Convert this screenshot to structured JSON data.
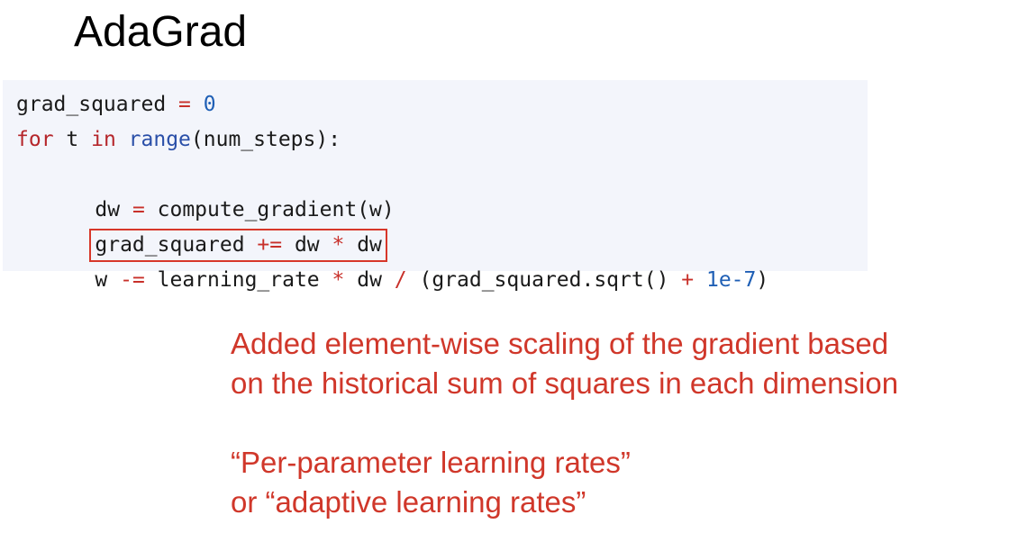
{
  "slide": {
    "title": "AdaGrad"
  },
  "code": {
    "line1": [
      {
        "t": "grad_squared ",
        "c": "plain"
      },
      {
        "t": "=",
        "c": "op"
      },
      {
        "t": " ",
        "c": "plain"
      },
      {
        "t": "0",
        "c": "num"
      }
    ],
    "line2": [
      {
        "t": "for",
        "c": "kw"
      },
      {
        "t": " t ",
        "c": "plain"
      },
      {
        "t": "in",
        "c": "kw"
      },
      {
        "t": " ",
        "c": "plain"
      },
      {
        "t": "range",
        "c": "fn"
      },
      {
        "t": "(num_steps):",
        "c": "plain"
      }
    ],
    "line3": [
      {
        "t": "dw ",
        "c": "plain"
      },
      {
        "t": "=",
        "c": "op"
      },
      {
        "t": " compute_gradient(w)",
        "c": "plain"
      }
    ],
    "line4": [
      {
        "t": "grad_squared ",
        "c": "plain"
      },
      {
        "t": "+=",
        "c": "op"
      },
      {
        "t": " dw ",
        "c": "plain"
      },
      {
        "t": "*",
        "c": "op"
      },
      {
        "t": " dw",
        "c": "plain"
      }
    ],
    "line5": [
      {
        "t": "w ",
        "c": "plain"
      },
      {
        "t": "-=",
        "c": "op"
      },
      {
        "t": " learning_rate ",
        "c": "plain"
      },
      {
        "t": "*",
        "c": "op"
      },
      {
        "t": " dw ",
        "c": "plain"
      },
      {
        "t": "/",
        "c": "op"
      },
      {
        "t": " (grad_squared.sqrt() ",
        "c": "plain"
      },
      {
        "t": "+",
        "c": "op"
      },
      {
        "t": " ",
        "c": "plain"
      },
      {
        "t": "1e-7",
        "c": "num"
      },
      {
        "t": ")",
        "c": "plain"
      }
    ]
  },
  "note": {
    "line1": "Added element-wise scaling of the gradient based",
    "line2": "on the historical sum of squares in each dimension",
    "line3": "“Per-parameter learning rates”",
    "line4": "or “adaptive learning rates”"
  },
  "colors": {
    "keyword": "#b5262b",
    "operator": "#c8302a",
    "builtin": "#2a4fa8",
    "number": "#1f5fb5",
    "highlight_box": "#d7372a",
    "note_text": "#d0372a",
    "code_background": "#f3f5fb"
  }
}
